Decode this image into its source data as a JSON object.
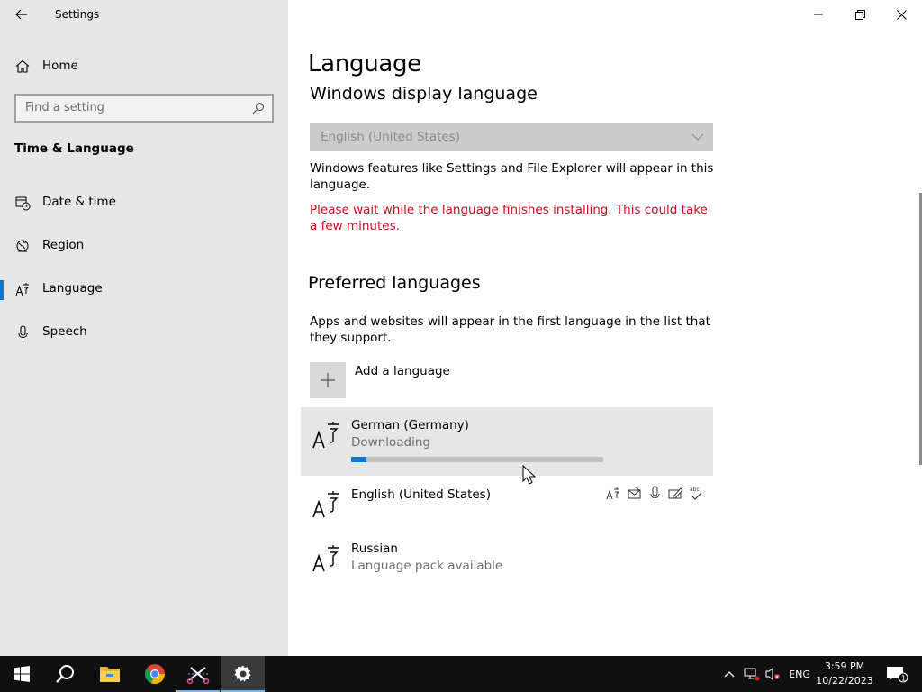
{
  "window": {
    "title": "Settings"
  },
  "nav": {
    "home_label": "Home",
    "search_placeholder": "Find a setting",
    "section_title": "Time & Language",
    "items": [
      {
        "label": "Date & time",
        "icon": "calendar-clock-icon",
        "selected": false
      },
      {
        "label": "Region",
        "icon": "globe-icon",
        "selected": false
      },
      {
        "label": "Language",
        "icon": "language-icon",
        "selected": true
      },
      {
        "label": "Speech",
        "icon": "microphone-icon",
        "selected": false
      }
    ]
  },
  "main": {
    "page_title": "Language",
    "display_language": {
      "heading": "Windows display language",
      "selected_value": "English (United States)",
      "description": "Windows features like Settings and File Explorer will appear in this language.",
      "warning": "Please wait while the language finishes installing. This could take a few minutes."
    },
    "preferred": {
      "heading": "Preferred languages",
      "description": "Apps and websites will appear in the first language in the list that they support.",
      "add_label": "Add a language",
      "languages": [
        {
          "name": "German (Germany)",
          "status": "Downloading",
          "progress": 0.06
        },
        {
          "name": "English (United States)",
          "status": "",
          "features": [
            "display-language-icon",
            "text-to-speech-icon",
            "speech-recognition-icon",
            "handwriting-icon",
            "spellcheck-icon"
          ]
        },
        {
          "name": "Russian",
          "status": "Language pack available"
        }
      ]
    }
  },
  "taskbar": {
    "apps": [
      "windows-start-icon",
      "search-icon",
      "file-explorer-icon",
      "chrome-icon",
      "snipping-tool-icon",
      "settings-icon"
    ],
    "tray": {
      "language": "ENG",
      "time": "3:59 PM",
      "date": "10/22/2023",
      "notification_count": "1"
    }
  },
  "colors": {
    "accent": "#0078d7",
    "warning": "#c50f1f",
    "nav_bg": "#e6e6e6",
    "taskbar_bg": "#101010"
  }
}
